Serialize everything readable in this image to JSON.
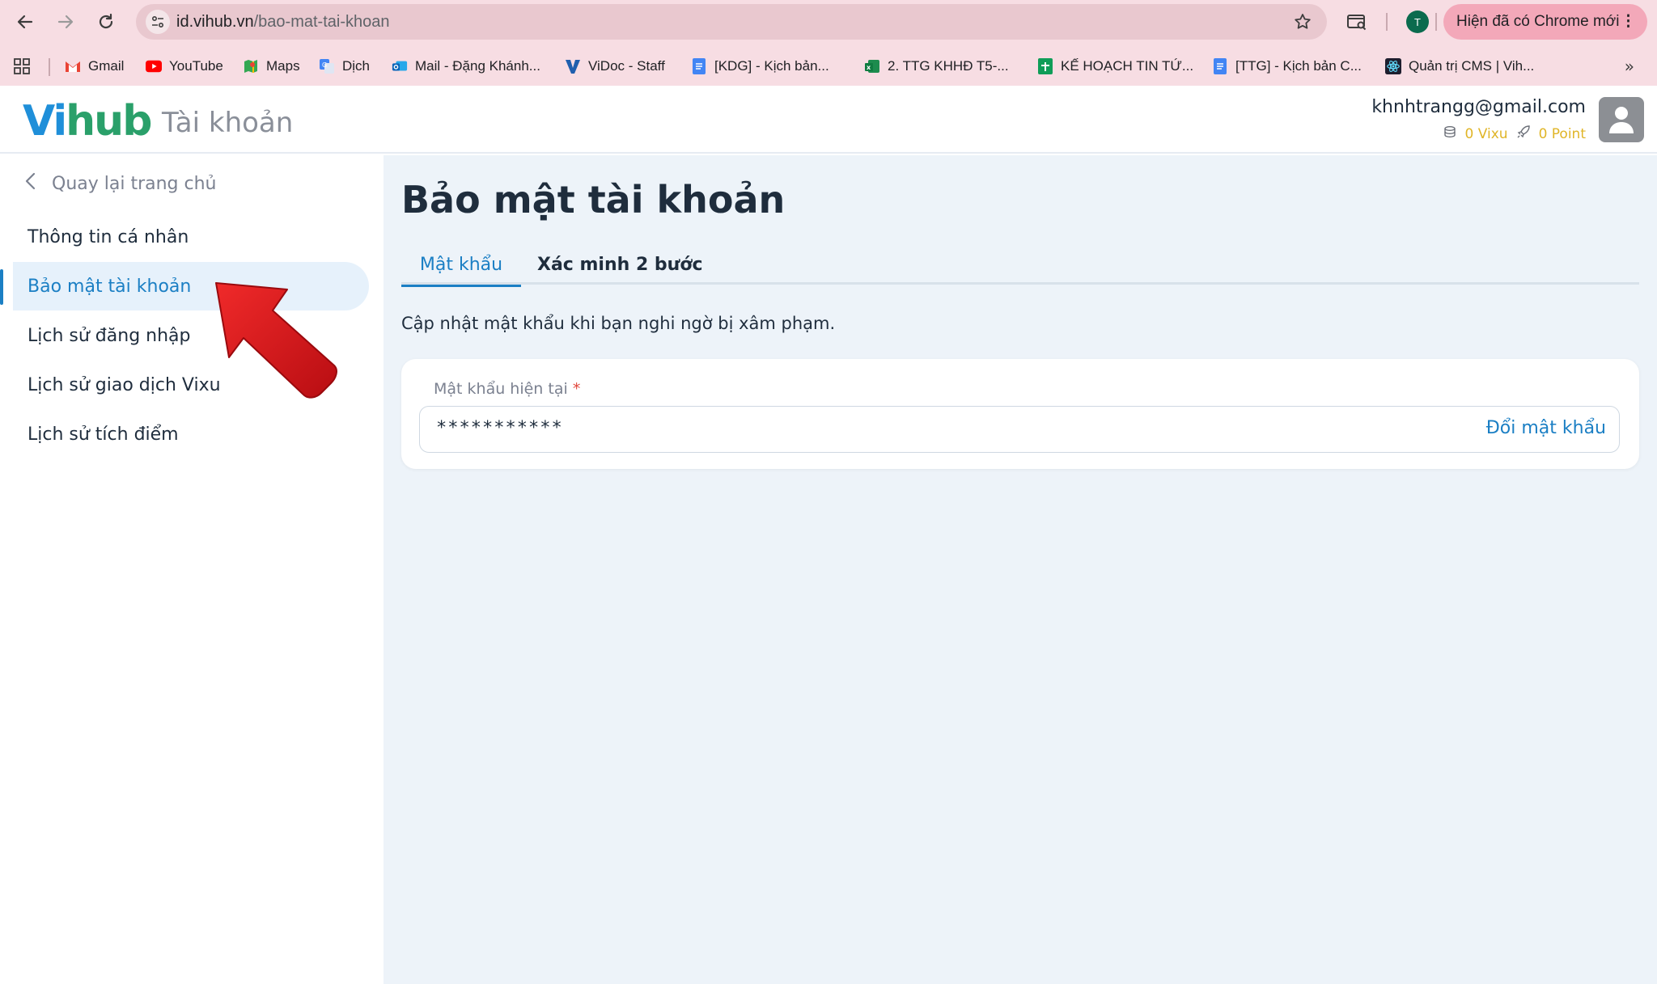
{
  "browser": {
    "url_host": "id.vihub.vn",
    "url_path": "/bao-mat-tai-khoan",
    "profile_initial": "T",
    "update_label": "Hiện đã có Chrome mới",
    "update_menu_glyph": "⋮",
    "bookmarks": [
      {
        "label": "Gmail",
        "icon": "gmail-icon"
      },
      {
        "label": "YouTube",
        "icon": "youtube-icon"
      },
      {
        "label": "Maps",
        "icon": "maps-icon"
      },
      {
        "label": "Dịch",
        "icon": "translate-icon"
      },
      {
        "label": "Mail - Đặng Khánh...",
        "icon": "outlook-icon"
      },
      {
        "label": "ViDoc - Staff",
        "icon": "vidoc-icon"
      },
      {
        "label": "[KDG] - Kịch bản...",
        "icon": "docs-icon"
      },
      {
        "label": "2. TTG KHHĐ T5-...",
        "icon": "excel-icon"
      },
      {
        "label": "KẾ HOẠCH TIN TỨ...",
        "icon": "sheets-icon"
      },
      {
        "label": "[TTG] - Kịch bản C...",
        "icon": "docs-icon"
      },
      {
        "label": "Quản trị CMS | Vih...",
        "icon": "react-icon"
      }
    ],
    "overflow_glyph": "»"
  },
  "header": {
    "logo_v": "Vi",
    "logo_rest": "hub",
    "logo_sub": "Tài khoản",
    "email": "khnhtrangg@gmail.com",
    "vixu": "0 Vixu",
    "point": "0 Point"
  },
  "sidebar": {
    "back_label": "Quay lại trang chủ",
    "items": [
      {
        "label": "Thông tin cá nhân"
      },
      {
        "label": "Bảo mật tài khoản"
      },
      {
        "label": "Lịch sử đăng nhập"
      },
      {
        "label": "Lịch sử giao dịch Vixu"
      },
      {
        "label": "Lịch sử tích điểm"
      }
    ]
  },
  "main": {
    "title": "Bảo mật tài khoản",
    "tabs": [
      {
        "label": "Mật khẩu"
      },
      {
        "label": "Xác minh 2 bước"
      }
    ],
    "description": "Cập nhật mật khẩu khi bạn nghi ngờ bị xâm phạm.",
    "password": {
      "label": "Mật khẩu hiện tại",
      "required_mark": "*",
      "value": "***********",
      "action_label": "Đổi mật khẩu"
    }
  },
  "colors": {
    "accent": "#1b7fc4",
    "active_bg": "#e6f1fb",
    "content_bg": "#edf3f9",
    "browser_bg": "#f7dde3",
    "arrow": "#d4121b"
  }
}
